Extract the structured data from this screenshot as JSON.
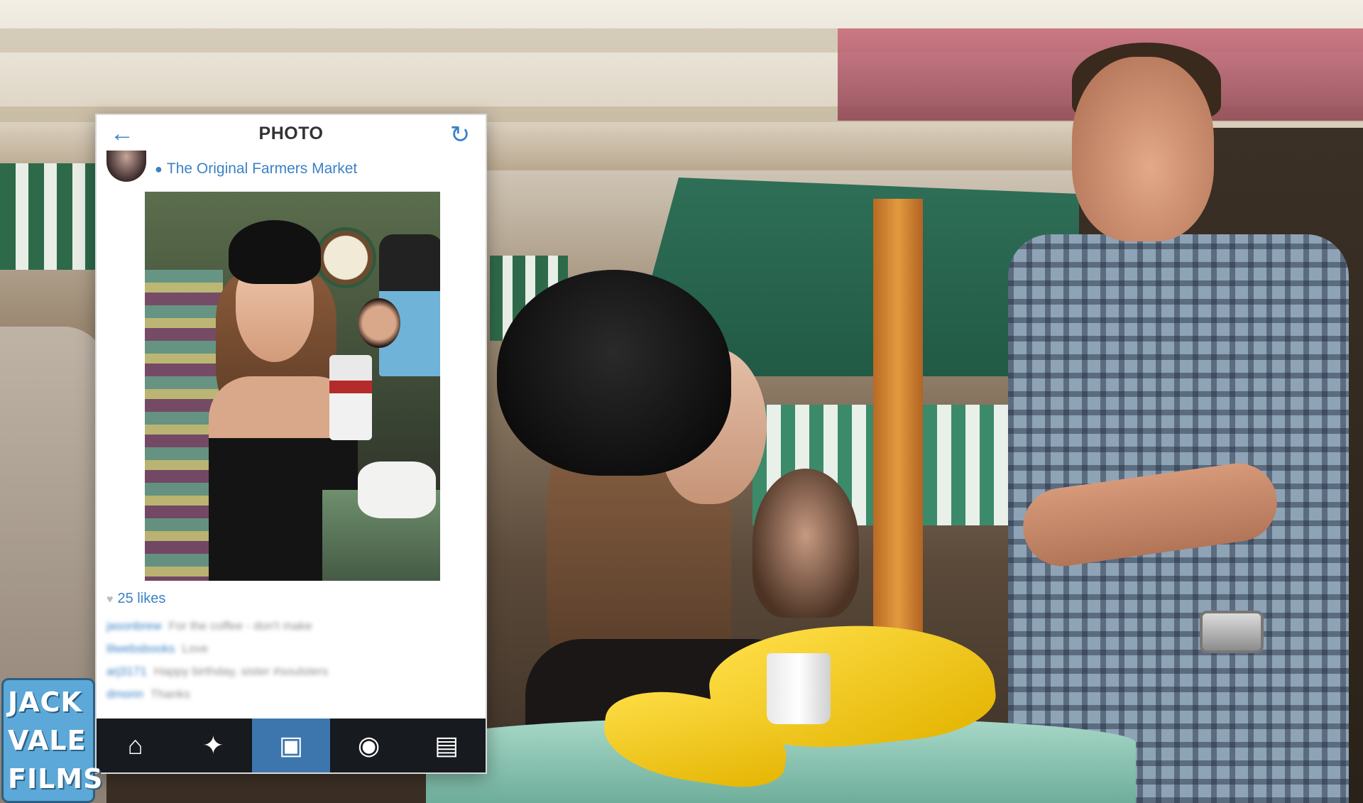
{
  "app": {
    "screen_title": "PHOTO"
  },
  "post": {
    "location": "The Original Farmers Market",
    "likes": "25 likes",
    "comments": [
      {
        "user": "jasonbrew",
        "text": "For the coffee - don't make"
      },
      {
        "user": "lilwebsbooks",
        "text": "Love"
      },
      {
        "user": "arj3171",
        "text": "Happy birthday, sister #soulsters"
      },
      {
        "user": "dmonn",
        "text": "Thanks"
      }
    ]
  },
  "tabbar": {
    "tabs": [
      {
        "name": "home",
        "icon": "home-icon",
        "glyph": "⌂",
        "active": false
      },
      {
        "name": "explore",
        "icon": "explore-star-icon",
        "glyph": "✦",
        "active": false
      },
      {
        "name": "camera",
        "icon": "camera-icon",
        "glyph": "▣",
        "active": true
      },
      {
        "name": "activity",
        "icon": "activity-bubble-icon",
        "glyph": "◉",
        "active": false
      },
      {
        "name": "profile",
        "icon": "profile-card-icon",
        "glyph": "▤",
        "active": false
      }
    ]
  },
  "icons": {
    "back": "back-arrow-icon",
    "back_glyph": "←",
    "refresh": "refresh-icon",
    "refresh_glyph": "↻",
    "location_pin_glyph": "●",
    "heart_glyph": "♥"
  },
  "watermark": {
    "lines": [
      "JACK",
      "VALE",
      "FILMS"
    ]
  },
  "colors": {
    "accent": "#3b82c6",
    "tabbar_bg": "#171a1e",
    "tab_active": "#3d76ad",
    "watermark_bg": "#5ca8d8"
  }
}
